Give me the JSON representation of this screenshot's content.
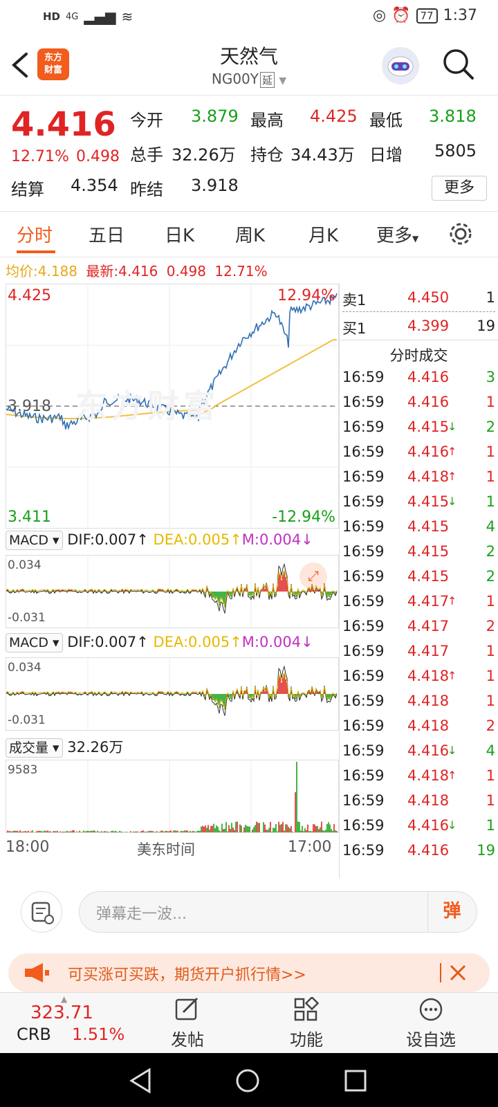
{
  "status_bar": {
    "left_icons": [
      "HD",
      "4G"
    ],
    "battery": "77",
    "time": "1:37"
  },
  "header": {
    "logo_line1": "东方",
    "logo_line2": "财富",
    "title": "天然气",
    "code": "NG00Y",
    "tag": "延"
  },
  "quote": {
    "price": "4.416",
    "change_pct": "12.71%",
    "change_val": "0.498",
    "open_label": "今开",
    "open": "3.879",
    "high_label": "最高",
    "high": "4.425",
    "low_label": "最低",
    "low": "3.818",
    "volume_label": "总手",
    "volume": "32.26万",
    "oi_label": "持仓",
    "oi": "34.43万",
    "daily_inc_label": "日增",
    "daily_inc": "5805",
    "settle_label": "结算",
    "settle": "4.354",
    "prev_settle_label": "昨结",
    "prev_settle": "3.918",
    "more_label": "更多"
  },
  "tabs": [
    "分时",
    "五日",
    "日K",
    "周K",
    "月K",
    "更多"
  ],
  "infoline": {
    "avg_label": "均价:",
    "avg": "4.188",
    "latest_label": "最新:",
    "latest": "4.416",
    "chg": "0.498",
    "pct": "12.71%"
  },
  "main_chart": {
    "high_label": "4.425",
    "high_pct": "12.94%",
    "mid_label": "3.918",
    "low_label": "3.411",
    "low_pct": "-12.94%",
    "watermark": "东方财富"
  },
  "macd1": {
    "selector": "MACD",
    "dif": "DIF:0.007",
    "dea": "DEA:0.005",
    "m": "M:0.004",
    "top": "0.034",
    "bottom": "-0.031"
  },
  "macd2": {
    "selector": "MACD",
    "dif": "DIF:0.007",
    "dea": "DEA:0.005",
    "m": "M:0.004",
    "top": "0.034",
    "bottom": "-0.031"
  },
  "volume": {
    "selector": "成交量",
    "total": "32.26万",
    "max": "9583"
  },
  "time_axis": {
    "start": "18:00",
    "middle": "美东时间",
    "end": "17:00"
  },
  "orderbook": {
    "sell_label": "卖1",
    "sell_price": "4.450",
    "sell_qty": "1",
    "buy_label": "买1",
    "buy_price": "4.399",
    "buy_qty": "19",
    "trades_title": "分时成交"
  },
  "trades": [
    {
      "time": "16:59",
      "price": "4.416",
      "qty": "3",
      "arrow": "",
      "qty_color": "#18a018"
    },
    {
      "time": "16:59",
      "price": "4.416",
      "qty": "1",
      "arrow": "",
      "qty_color": "#e02424"
    },
    {
      "time": "16:59",
      "price": "4.415",
      "qty": "2",
      "arrow": "↓",
      "qty_color": "#18a018"
    },
    {
      "time": "16:59",
      "price": "4.416",
      "qty": "1",
      "arrow": "↑",
      "qty_color": "#e02424"
    },
    {
      "time": "16:59",
      "price": "4.418",
      "qty": "1",
      "arrow": "↑",
      "qty_color": "#e02424"
    },
    {
      "time": "16:59",
      "price": "4.415",
      "qty": "1",
      "arrow": "↓",
      "qty_color": "#18a018"
    },
    {
      "time": "16:59",
      "price": "4.415",
      "qty": "4",
      "arrow": "",
      "qty_color": "#18a018"
    },
    {
      "time": "16:59",
      "price": "4.415",
      "qty": "2",
      "arrow": "",
      "qty_color": "#18a018"
    },
    {
      "time": "16:59",
      "price": "4.415",
      "qty": "2",
      "arrow": "",
      "qty_color": "#18a018"
    },
    {
      "time": "16:59",
      "price": "4.417",
      "qty": "1",
      "arrow": "↑",
      "qty_color": "#e02424"
    },
    {
      "time": "16:59",
      "price": "4.417",
      "qty": "2",
      "arrow": "",
      "qty_color": "#e02424"
    },
    {
      "time": "16:59",
      "price": "4.417",
      "qty": "1",
      "arrow": "",
      "qty_color": "#e02424"
    },
    {
      "time": "16:59",
      "price": "4.418",
      "qty": "1",
      "arrow": "↑",
      "qty_color": "#e02424"
    },
    {
      "time": "16:59",
      "price": "4.418",
      "qty": "1",
      "arrow": "",
      "qty_color": "#e02424"
    },
    {
      "time": "16:59",
      "price": "4.418",
      "qty": "2",
      "arrow": "",
      "qty_color": "#e02424"
    },
    {
      "time": "16:59",
      "price": "4.416",
      "qty": "4",
      "arrow": "↓",
      "qty_color": "#18a018"
    },
    {
      "time": "16:59",
      "price": "4.418",
      "qty": "1",
      "arrow": "↑",
      "qty_color": "#e02424"
    },
    {
      "time": "16:59",
      "price": "4.418",
      "qty": "1",
      "arrow": "",
      "qty_color": "#e02424"
    },
    {
      "time": "16:59",
      "price": "4.416",
      "qty": "1",
      "arrow": "↓",
      "qty_color": "#18a018"
    },
    {
      "time": "16:59",
      "price": "4.416",
      "qty": "19",
      "arrow": "",
      "qty_color": "#18a018"
    }
  ],
  "danmu": {
    "placeholder": "弹幕走一波...",
    "send_label": "弹"
  },
  "banner": {
    "text": "可买涨可买跌，期货开户抓行情>>"
  },
  "toolbar": {
    "index_value": "323.71",
    "index_name": "CRB",
    "index_pct": "1.51%",
    "post": "发帖",
    "func": "功能",
    "watch": "设自选"
  },
  "colors": {
    "accent": "#f25c1d",
    "up": "#e02424",
    "down": "#18a018",
    "avg_line": "#f0c040",
    "price_line": "#2f6fb5"
  }
}
